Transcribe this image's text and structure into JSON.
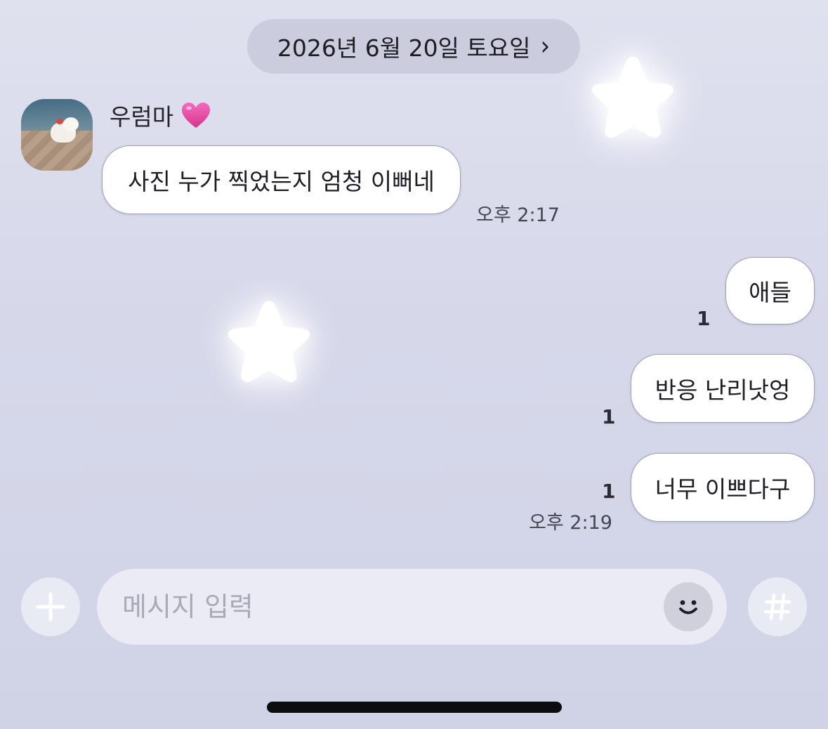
{
  "header": {
    "date_label": "2026년 6월 20일 토요일",
    "chevron": "›"
  },
  "incoming": {
    "sender_name": "우럼마",
    "sender_emoji": "pink-heart-icon",
    "messages": [
      {
        "text": "사진 누가 찍었는지 엄청 이뻐네",
        "time": "오후 2:17"
      }
    ]
  },
  "outgoing": {
    "messages": [
      {
        "text": "애들",
        "unread": "1"
      },
      {
        "text": "반응 난리낫엉",
        "unread": "1"
      },
      {
        "text": "너무 이쁘다구",
        "unread": "1"
      }
    ],
    "time": "오후 2:19"
  },
  "composer": {
    "placeholder": "메시지 입력",
    "value": "",
    "left_button": "plus-icon",
    "emoji_button": "smiley-icon",
    "right_button": "hashtag-icon"
  },
  "colors": {
    "background": "#d6d8ea",
    "bubble": "#ffffff",
    "bubble_border": "#9c9fba",
    "heart": "#e4479a"
  }
}
